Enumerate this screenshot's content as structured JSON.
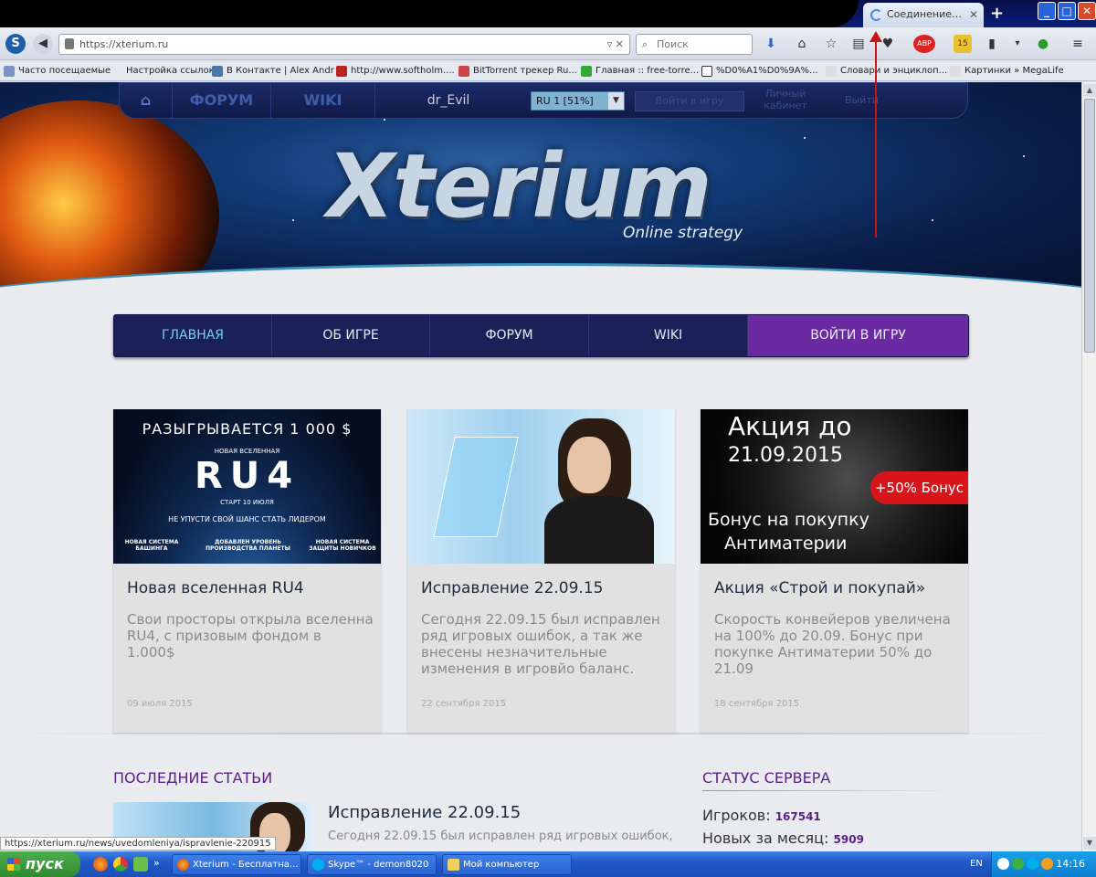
{
  "browser": {
    "tab_title": "Соединение…",
    "url": "https://xterium.ru",
    "search_placeholder": "Поиск",
    "abp_label": "ABP",
    "notif_count": "15",
    "bookmarks": [
      "Часто посещаемые",
      "Настройка ссылок",
      "В Контакте | Alex Andr",
      "http://www.softholm....",
      "BitTorrent трекер Ru...",
      "Главная :: free-torre...",
      "%D0%A1%D0%9A%...",
      "Словари и энциклоп...",
      "Картинки » MegaLife"
    ],
    "window_controls": [
      "_",
      "□",
      "✕"
    ],
    "status_url": "https://xterium.ru/news/uvedomleniya/ispravlenie-220915"
  },
  "topmenu": {
    "forum": "ФОРУМ",
    "wiki": "WIKI",
    "username": "dr_Evil",
    "server": "RU 1 [51%]",
    "enter_game": "Войти в игру",
    "cabinet": "Личный кабинет",
    "logout": "Выйти"
  },
  "banner": {
    "logo": "Xterium",
    "tagline": "Online strategy"
  },
  "mainmenu": {
    "home": "ГЛАВНАЯ",
    "about": "ОБ ИГРЕ",
    "forum": "ФОРУМ",
    "wiki": "WIKI",
    "enter": "ВОЙТИ В ИГРУ"
  },
  "cards": [
    {
      "title": "Новая вселенная RU4",
      "text": "Свои просторы открыла вселенна RU4, с призовым фондом в 1.000$",
      "date": "09 июля 2015",
      "img": {
        "headline": "РАЗЫГРЫВАЕТСЯ 1 000 $",
        "sub1": "НОВАЯ ВСЕЛЕННАЯ",
        "big": "RU4",
        "sub2": "СТАРТ 10 ИЮЛЯ",
        "sub3": "НЕ УПУСТИ СВОЙ ШАНС СТАТЬ ЛИДЕРОМ",
        "f1": "НОВАЯ СИСТЕМА БАШИНГА",
        "f2": "ДОБАВЛЕН УРОВЕНЬ ПРОИЗВОДСТВА ПЛАНЕТЫ",
        "f3": "НОВАЯ СИСТЕМА ЗАЩИТЫ НОВИЧКОВ"
      }
    },
    {
      "title": "Исправление 22.09.15",
      "text": "Сегодня 22.09.15 был исправлен ряд игровых ошибок, а так же внесены незначительные изменения в игровйо баланс.",
      "date": "22 сентября 2015"
    },
    {
      "title": "Акция «Строй и покупай»",
      "text": "Скорость конвейеров увеличена на 100% до 20.09. Бонус при покупке Антиматерии 50% до 21.09",
      "date": "18 сентября 2015",
      "img": {
        "line1": "Акция до",
        "line2": "21.09.2015",
        "badge": "+50% Бонус",
        "line3": "Бонус на покупку",
        "line4": "Антиматерии"
      }
    }
  ],
  "articles": {
    "heading": "ПОСЛЕДНИЕ СТАТЬИ",
    "title": "Исправление 22.09.15",
    "text": "Сегодня 22.09.15 был исправлен ряд игровых ошибок,"
  },
  "server_status": {
    "heading": "СТАТУС СЕРВЕРА",
    "players_label": "Игроков:",
    "players_value": "167541",
    "new_label": "Новых за месяц:",
    "new_value": "5909"
  },
  "taskbar": {
    "start": "пуск",
    "tasks": [
      "Xterium - Бесплатна...",
      "Skype™ - demon8020",
      "Мой компьютер"
    ],
    "lang": "EN",
    "clock": "14:16"
  }
}
